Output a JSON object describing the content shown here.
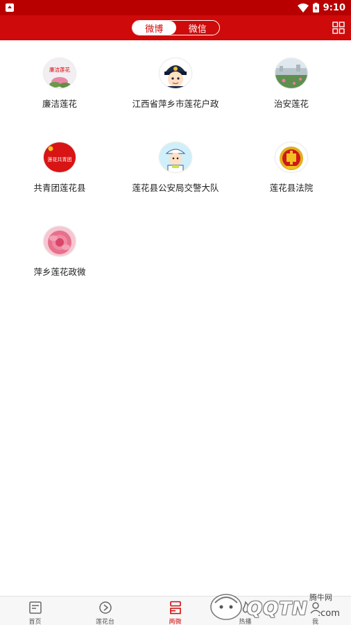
{
  "status_bar": {
    "time": "9:10"
  },
  "header": {
    "tabs": [
      {
        "label": "微博",
        "active": true
      },
      {
        "label": "微信",
        "active": false
      }
    ]
  },
  "accounts": [
    {
      "name": "廉洁莲花",
      "avatar_text": "廉洁莲花"
    },
    {
      "name": "江西省萍乡市莲花户政"
    },
    {
      "name": "治安莲花"
    },
    {
      "name": "共青团莲花县",
      "avatar_text": "莲花共青团"
    },
    {
      "name": "莲花县公安局交警大队"
    },
    {
      "name": "莲花县法院"
    },
    {
      "name": "萍乡莲花政微"
    }
  ],
  "bottom_nav": [
    {
      "label": "首页",
      "icon": "news-icon"
    },
    {
      "label": "莲花台",
      "icon": "play-icon"
    },
    {
      "label": "两微",
      "icon": "two-micro-icon",
      "active": true
    },
    {
      "label": "热播",
      "icon": "hot-icon"
    },
    {
      "label": "我",
      "icon": "user-icon"
    }
  ],
  "watermark": {
    "brand": "QQTN",
    "cn": "腾牛网",
    "domain": ".com"
  },
  "colors": {
    "primary": "#cf0a0a",
    "status_bar": "#b80000",
    "tab_bar": "#f7f7f7"
  }
}
